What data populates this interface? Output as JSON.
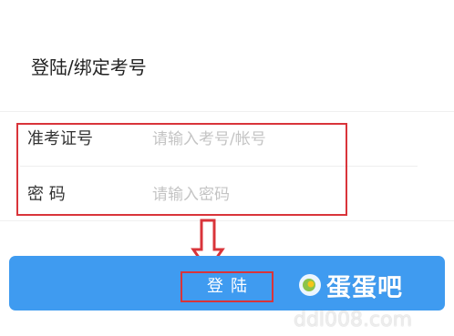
{
  "page": {
    "title": "登陆/绑定考号"
  },
  "form": {
    "exam_id_label": "准考证号",
    "exam_id_placeholder": "请输入考号/帐号",
    "password_label": "密 码",
    "password_placeholder": "请输入密码"
  },
  "login_button": {
    "label": "登陆"
  },
  "watermark": {
    "brand": "蛋蛋吧",
    "url": "ddl008.com"
  },
  "colors": {
    "accent": "#3f9bf0",
    "annotation": "#d9343a"
  },
  "icons": {
    "annotation_arrow": "down-arrow-icon",
    "watermark_logo": "egg-logo-icon"
  }
}
